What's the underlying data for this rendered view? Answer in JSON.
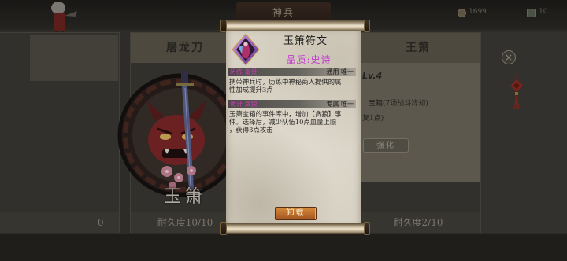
{
  "header": {
    "title": "神兵",
    "currency": {
      "icon": "coin-icon",
      "value": "1699"
    },
    "secondary": {
      "icon": "token-icon",
      "value": "10"
    }
  },
  "cards": {
    "far_left": {
      "durability": "0"
    },
    "left": {
      "name": "屠龙刀",
      "weapon_name": "玉箫",
      "durability": "耐久度10/10",
      "emblem_icons": [
        "oni-mask-icon",
        "sword-icon",
        "blossom-icon"
      ]
    },
    "right": {
      "name": "王箫",
      "level": "Lv.4",
      "desc_lines": [
        "宝箱(7场战斗冷却)",
        "复1点)"
      ],
      "upgrade_label": "强化",
      "durability": "耐久度2/10"
    },
    "side": {
      "close_icon": "close-icon",
      "close_glyph": "×",
      "decoration_icon": "chinese-knot-icon"
    }
  },
  "modal": {
    "icon": "rune-icon",
    "title": "玉箫符文",
    "quality": "品质:史诗",
    "sections": [
      {
        "tag": "历练 富贵",
        "scope": "通用 唯一",
        "description_lines": [
          "携带神兵时，历练中神秘商人提供的属",
          "性加成提升3点"
        ]
      },
      {
        "tag": "诡计 贪狼",
        "scope": "专属 唯一",
        "description_lines": [
          "玉箫宝箱的事件库中，增加【贪狼】事",
          "件。选择后，减少队伍10点血量上限",
          "，获得3点攻击"
        ]
      }
    ],
    "unequip_label": "卸载"
  },
  "colors": {
    "quality_epic": "#c23bd0",
    "section_tag": "#c93bb8",
    "button_top": "#d68b3c",
    "button_bottom": "#a4561f",
    "paper": "#d8d2c4"
  }
}
